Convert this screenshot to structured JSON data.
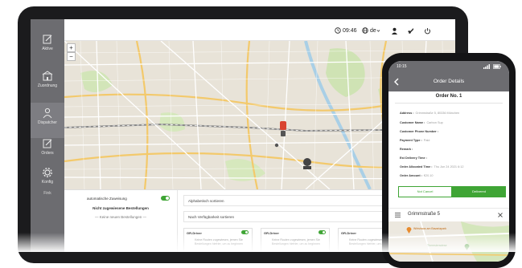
{
  "sidebar": {
    "items": [
      {
        "label": "Aktive",
        "icon": "edit-icon"
      },
      {
        "label": "Zuordnung",
        "icon": "building-icon"
      },
      {
        "label": "Dispatcher",
        "icon": "person-icon"
      },
      {
        "label": "Orders",
        "icon": "edit-icon"
      },
      {
        "label": "Konfig",
        "icon": "gear-icon"
      }
    ],
    "footer": "Fink"
  },
  "topbar": {
    "time": "09:46",
    "language": "de",
    "icons": [
      "clock-icon",
      "globe-icon",
      "user-icon",
      "rocket-icon",
      "power-icon"
    ]
  },
  "map": {
    "zoom_in": "+",
    "zoom_out": "−"
  },
  "panel": {
    "auto_assign_label": "automatische Zuweisung",
    "unassigned_title": "Nicht zugewiesene Bestellungen",
    "no_new_orders": "— Keine neuen Bestellungen —",
    "sort_alpha": "Alphabetisch sortieren",
    "sort_availability": "Nach Verfügbarkeit sortieren",
    "drivers": [
      {
        "name": "GR-Driver",
        "note": "Keine Routen zugewiesen, jemen Sie Bestellungen hiefrier, um zu beginnen"
      },
      {
        "name": "GR-Driver",
        "note": "Keine Routen zugewiesen, jemen Sie Bestellungen hiefrier, um zu beginnen"
      },
      {
        "name": "GR-Driver",
        "note": "Keine Routen zugewiesen, jemen Sie Bestellungen hiefrier, um zu beginnen"
      }
    ]
  },
  "phone": {
    "status_time": "10:15",
    "header_title": "Order Details",
    "order_no": "Order No. 1",
    "fields": [
      {
        "label": "Address :",
        "value": "Grimmstraße 5, 80336 München"
      },
      {
        "label": "Customer Name :",
        "value": "Carbon Sup"
      },
      {
        "label": "Customer Phone Number :",
        "value": ""
      },
      {
        "label": "Payment Type :",
        "value": "Paid"
      },
      {
        "label": "Remark :",
        "value": ""
      },
      {
        "label": "Est Delivery Time :",
        "value": ""
      },
      {
        "label": "Order Allocated Time :",
        "value": "Thu Jun 24 2021 6:12"
      },
      {
        "label": "Order Amount :",
        "value": "€20.10"
      }
    ],
    "cancel_label": "Not Cancel",
    "accept_label": "Delivered",
    "route_title": "Grimmstraße 5",
    "map_labels": [
      "Wirtshaus am Bavariapark",
      "Theresienwiese"
    ]
  },
  "colors": {
    "accent": "#3fa535",
    "sidebar": "#6c6c70",
    "bezel": "#1b1b1d"
  }
}
